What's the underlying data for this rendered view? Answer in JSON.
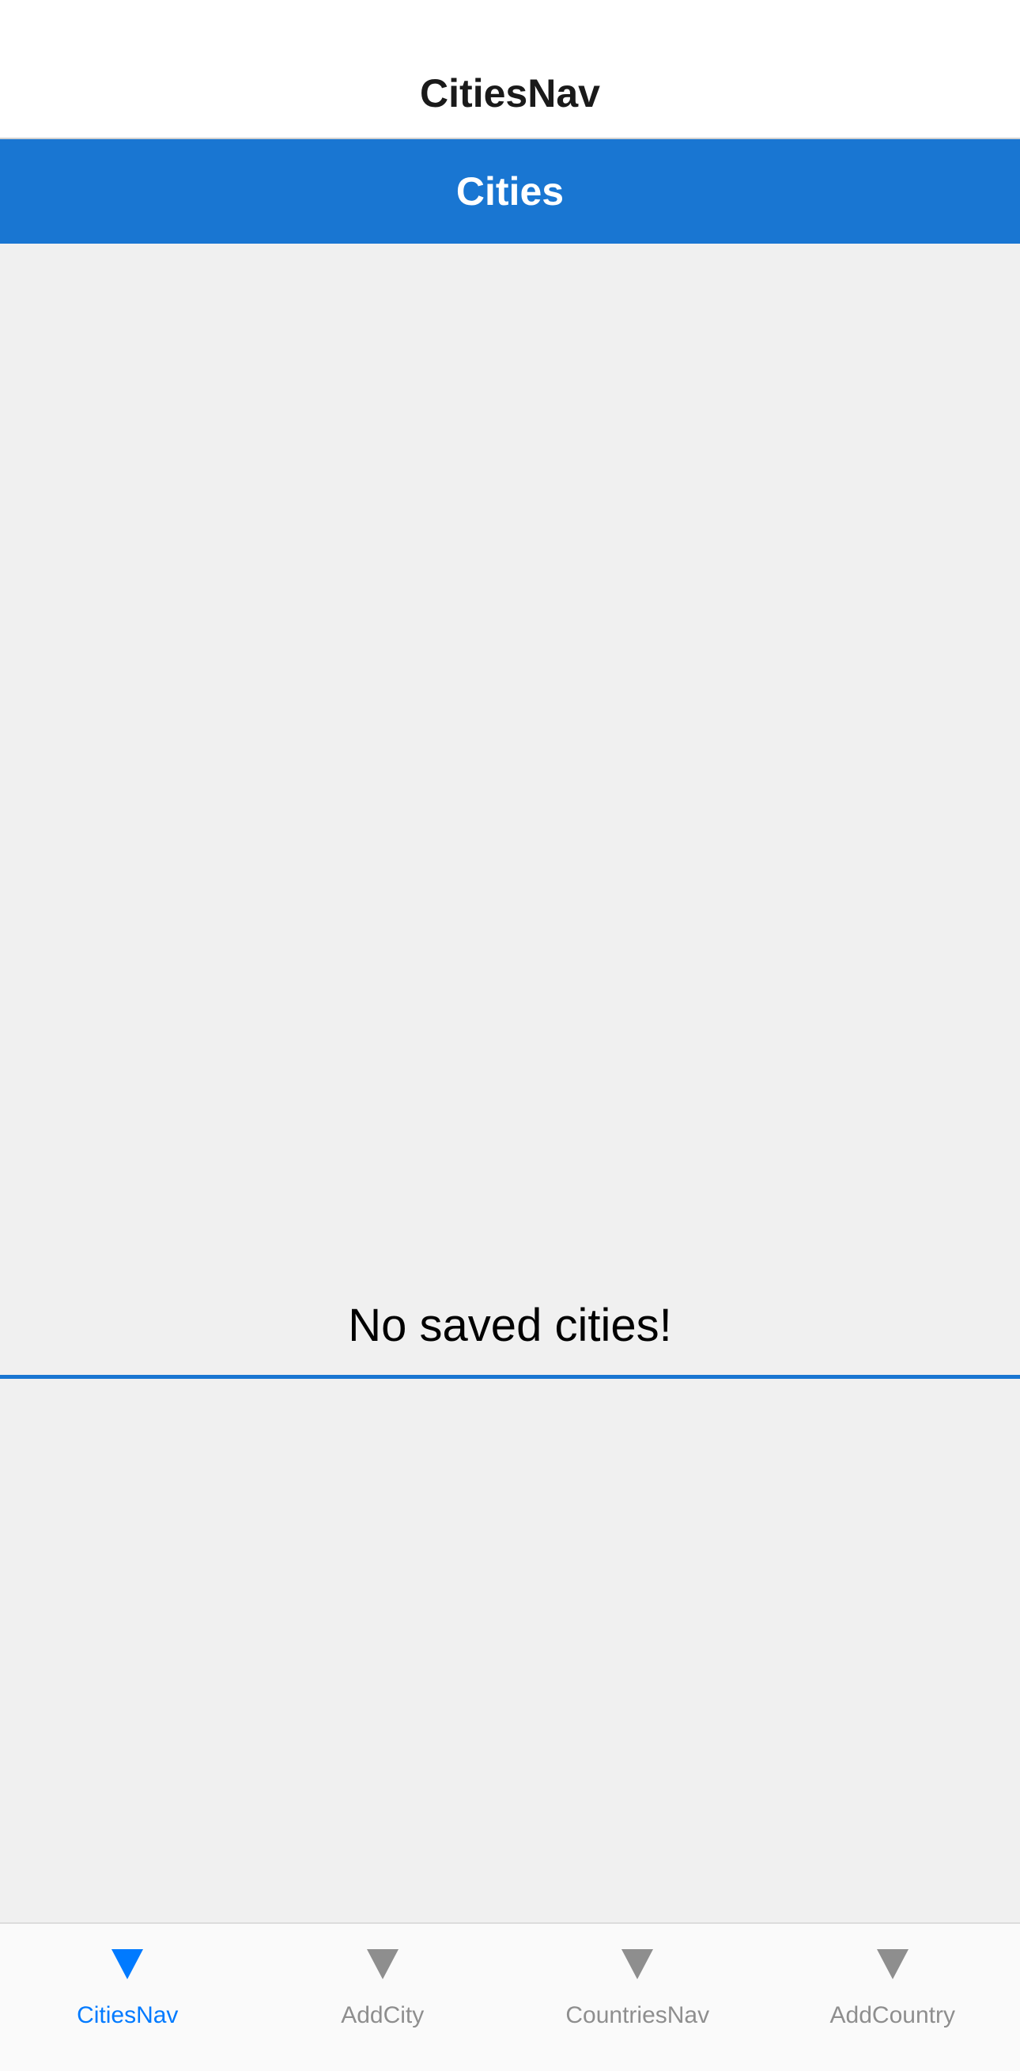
{
  "nav": {
    "title": "CitiesNav"
  },
  "header": {
    "title": "Cities"
  },
  "main": {
    "empty_message": "No saved cities!"
  },
  "tabs": [
    {
      "label": "CitiesNav",
      "icon": "triangle-down-icon",
      "active": true
    },
    {
      "label": "AddCity",
      "icon": "triangle-down-icon",
      "active": false
    },
    {
      "label": "CountriesNav",
      "icon": "triangle-down-icon",
      "active": false
    },
    {
      "label": "AddCountry",
      "icon": "triangle-down-icon",
      "active": false
    }
  ],
  "colors": {
    "accent": "#1976d2",
    "tab_active": "#007aff",
    "tab_inactive": "#8e8e8e",
    "background": "#f0f0f0"
  }
}
